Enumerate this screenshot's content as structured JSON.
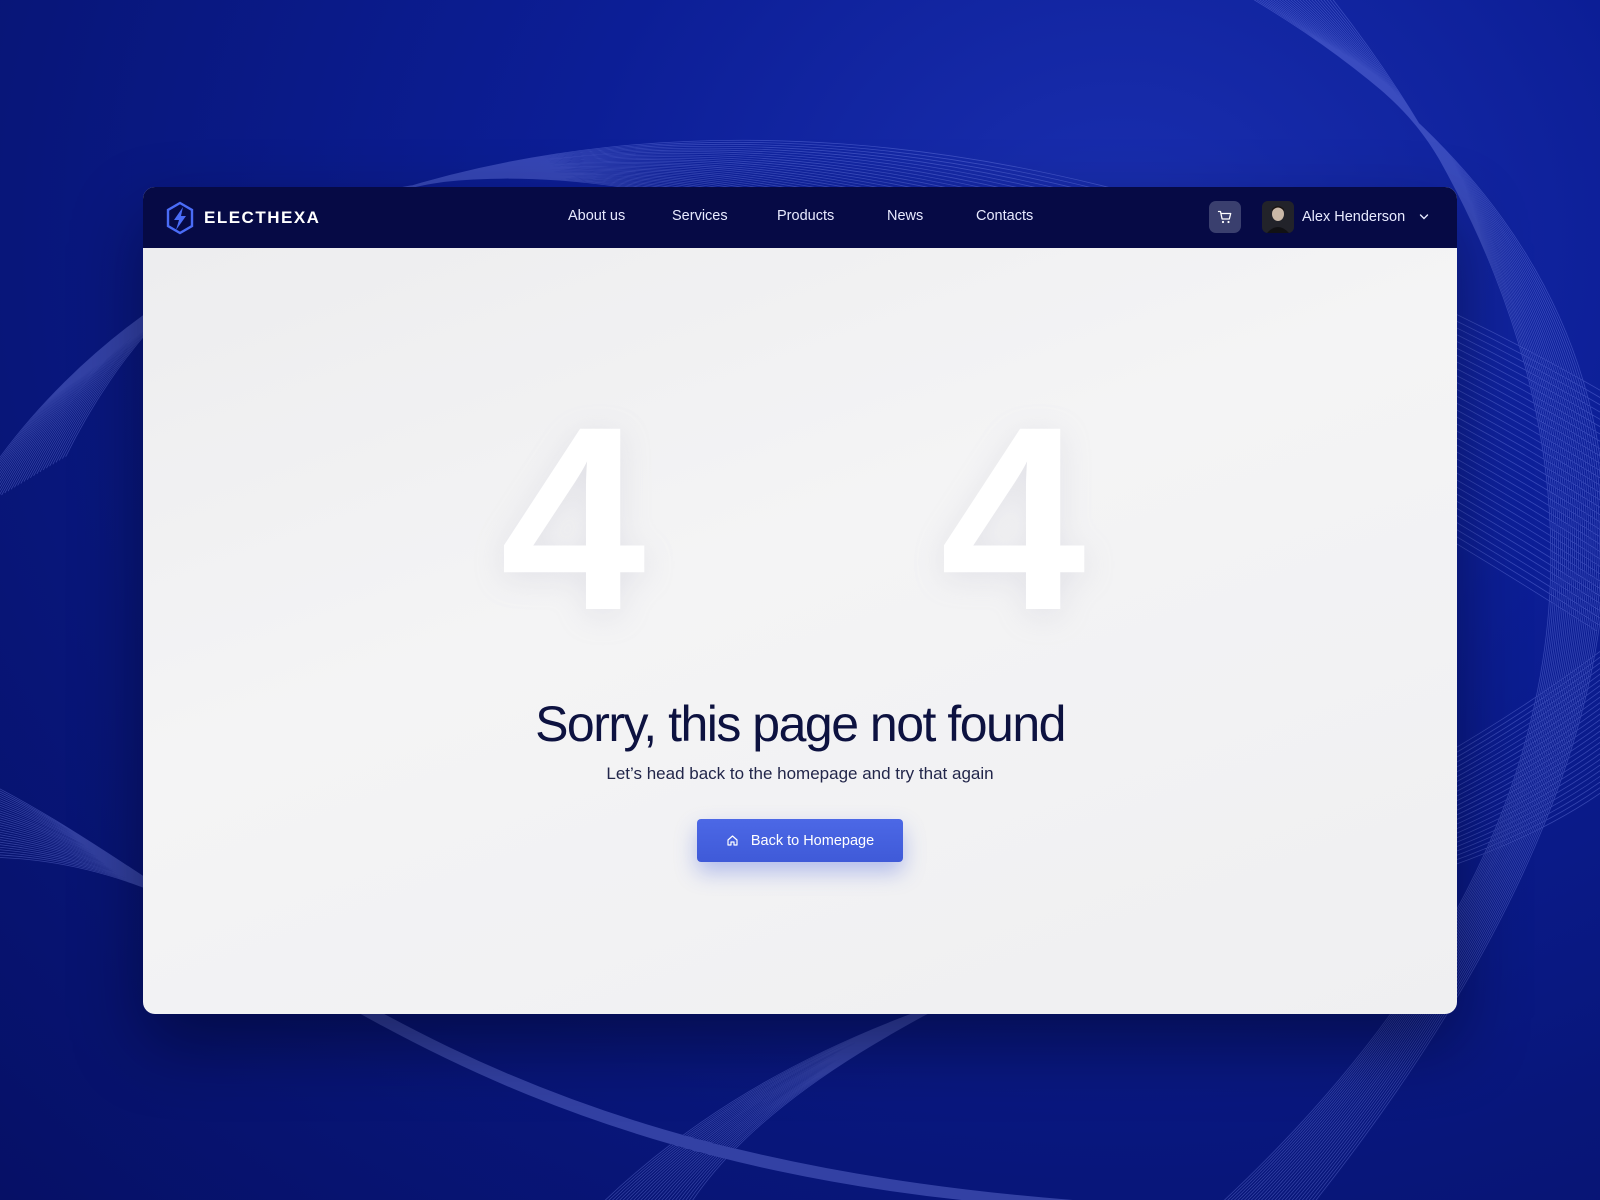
{
  "brand": {
    "name": "ELECTHEXA",
    "logo_icon": "hexagon-lightning-icon",
    "accent_color": "#4a6cf7"
  },
  "nav": {
    "items": [
      {
        "label": "About us"
      },
      {
        "label": "Services"
      },
      {
        "label": "Products"
      },
      {
        "label": "News"
      },
      {
        "label": "Contacts"
      }
    ]
  },
  "header": {
    "cart_icon": "cart-icon",
    "user_name": "Alex Henderson",
    "dropdown_icon": "chevron-down-icon"
  },
  "error": {
    "digit_left": "4",
    "digit_right": "4",
    "title": "Sorry, this page not found",
    "subtitle": "Let’s head back to the homepage and try that again",
    "button_label": "Back to Homepage",
    "button_icon": "home-icon",
    "button_color": "#4661e0"
  },
  "colors": {
    "background": "#0a1a8c",
    "navbar": "#060a45",
    "content": "#f1f1f3",
    "title_text": "#0d1240"
  }
}
